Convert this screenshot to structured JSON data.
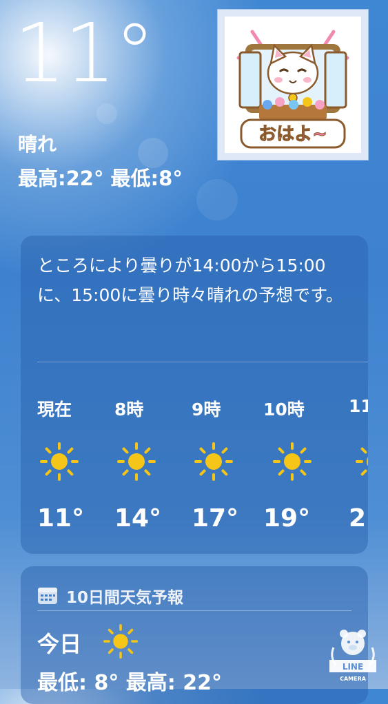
{
  "current": {
    "temperature": "11°",
    "condition": "晴れ",
    "high_low": "最高:22°  最低:8°"
  },
  "sticker": {
    "text": "おはよ~"
  },
  "hourly_card": {
    "summary": "ところにより曇りが14:00から15:00に、15:00に曇り時々晴れの予想です。",
    "hours": [
      {
        "time": "現在",
        "icon": "sun-icon",
        "temp": "11°"
      },
      {
        "time": "8時",
        "icon": "sun-icon",
        "temp": "14°"
      },
      {
        "time": "9時",
        "icon": "sun-icon",
        "temp": "17°"
      },
      {
        "time": "10時",
        "icon": "sun-icon",
        "temp": "19°"
      },
      {
        "time": "11",
        "icon": "sun-icon",
        "temp": "2"
      }
    ]
  },
  "forecast_card": {
    "header": "10日間天気予報",
    "header_icon": "calendar-icon",
    "today_label": "今日",
    "today_icon": "sun-icon",
    "today_range": "最低: 8°  最高: 22°"
  },
  "watermark": {
    "text_top": "LINE",
    "text_bottom": "CAMERA"
  },
  "colors": {
    "sun": "#f5c518",
    "background": "#3f86d3",
    "card": "#2d63aa"
  }
}
